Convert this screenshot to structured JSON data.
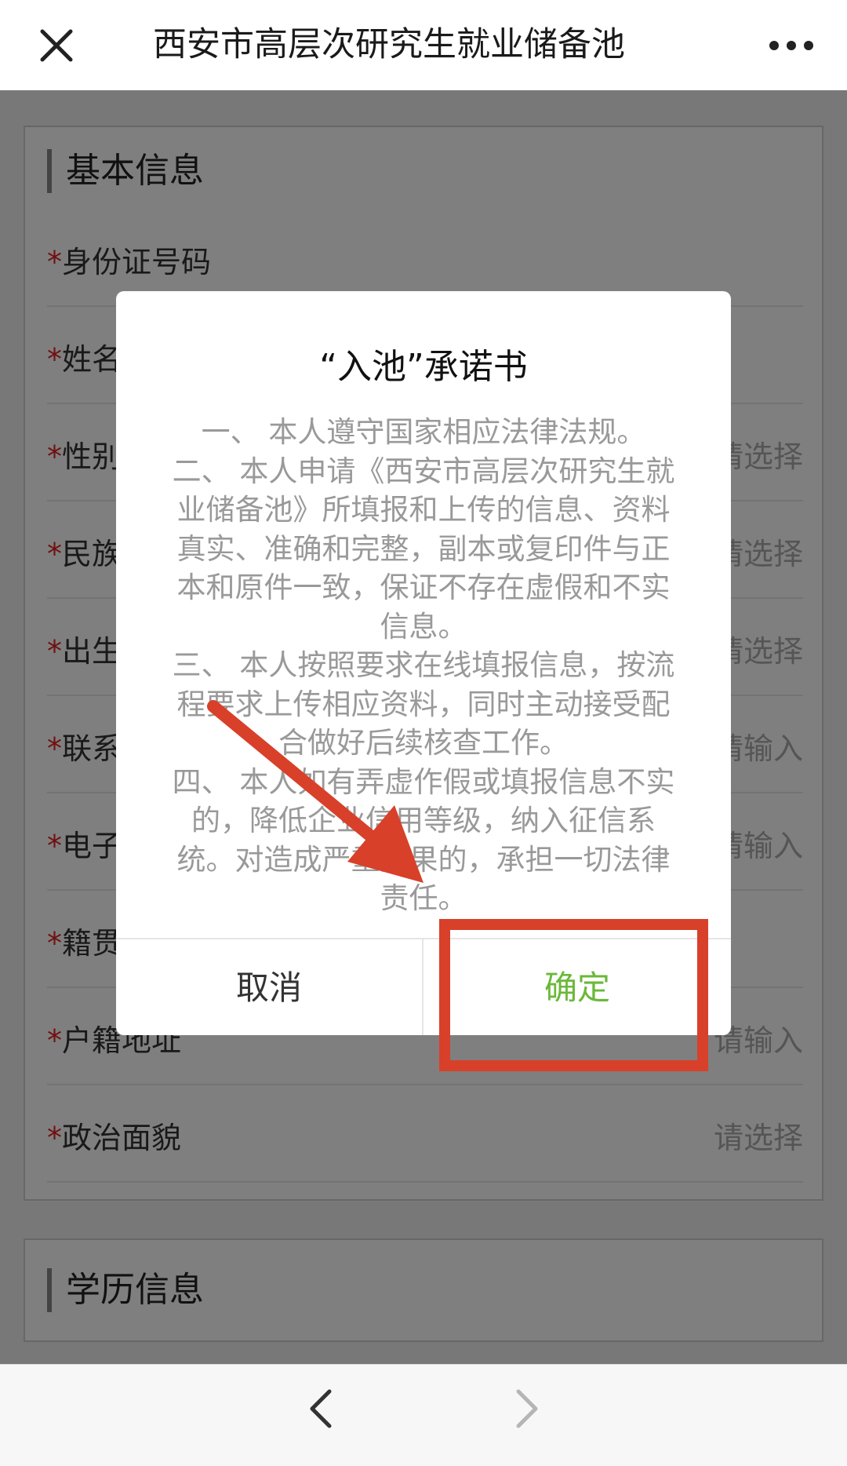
{
  "header": {
    "title": "西安市高层次研究生就业储备池"
  },
  "form": {
    "required_mark": "*",
    "basic_section": {
      "title": "基本信息",
      "fields": [
        {
          "label": "身份证号码",
          "hint": ""
        },
        {
          "label": "姓名",
          "hint": ""
        },
        {
          "label": "性别",
          "hint": "请选择"
        },
        {
          "label": "民族",
          "hint": "请选择"
        },
        {
          "label": "出生日期",
          "hint": "请选择"
        },
        {
          "label": "联系电话",
          "hint": "请输入"
        },
        {
          "label": "电子邮箱",
          "hint": "请输入"
        },
        {
          "label": "籍贯",
          "hint": ""
        },
        {
          "label": "户籍地址",
          "hint": "请输入"
        },
        {
          "label": "政治面貌",
          "hint": "请选择"
        }
      ]
    },
    "education_section": {
      "title": "学历信息"
    }
  },
  "dialog": {
    "title": "“入池”承诺书",
    "paragraphs": [
      "一、 本人遵守国家相应法律法规。",
      "二、 本人申请《西安市高层次研究生就业储备池》所填报和上传的信息、资料真实、准确和完整，副本或复印件与正本和原件一致，保证不存在虚假和不实信息。",
      "三、 本人按照要求在线填报信息，按流程要求上传相应资料，同时主动接受配合做好后续核查工作。",
      "四、 本人如有弄虚作假或填报信息不实的，降低企业信用等级，纳入征信系统。对造成严重后果的，承担一切法律责任。"
    ],
    "cancel_label": "取消",
    "confirm_label": "确定"
  },
  "colors": {
    "confirm_text": "#6bb83a",
    "annotation": "#d8402a",
    "required": "#e02020"
  },
  "icons": {
    "close": "close-icon",
    "more": "more-icon",
    "back": "chevron-left-icon",
    "forward": "chevron-right-icon"
  }
}
